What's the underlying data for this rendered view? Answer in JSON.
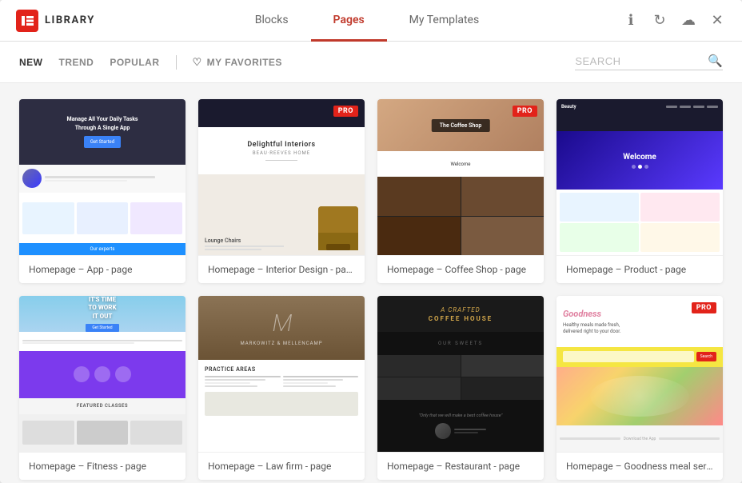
{
  "header": {
    "logo_text": "LIBRARY",
    "tabs": [
      {
        "id": "blocks",
        "label": "Blocks",
        "active": false
      },
      {
        "id": "pages",
        "label": "Pages",
        "active": true
      },
      {
        "id": "my-templates",
        "label": "My Templates",
        "active": false
      }
    ],
    "icons": {
      "info": "ℹ",
      "refresh": "↻",
      "save": "☁",
      "close": "✕"
    }
  },
  "filters": {
    "new_label": "NEW",
    "trend_label": "TREND",
    "popular_label": "POPULAR",
    "favorites_label": "MY FAVORITES"
  },
  "search": {
    "placeholder": "SEARCH"
  },
  "templates": [
    {
      "id": "app",
      "label": "Homepage – App - page",
      "pro": false,
      "thumb_type": "app"
    },
    {
      "id": "interior",
      "label": "Homepage – Interior Design - page",
      "pro": true,
      "thumb_type": "interior"
    },
    {
      "id": "coffee",
      "label": "Homepage – Coffee Shop - page",
      "pro": true,
      "thumb_type": "coffee"
    },
    {
      "id": "product",
      "label": "Homepage – Product - page",
      "pro": false,
      "thumb_type": "product"
    },
    {
      "id": "fitness",
      "label": "Homepage – Fitness - page",
      "pro": false,
      "thumb_type": "fitness"
    },
    {
      "id": "law",
      "label": "Homepage – Law firm - page",
      "pro": false,
      "thumb_type": "law"
    },
    {
      "id": "restaurant",
      "label": "Homepage – Restaurant - page",
      "pro": false,
      "thumb_type": "restaurant"
    },
    {
      "id": "goodness",
      "label": "Homepage – Goodness meal servi...",
      "pro": true,
      "thumb_type": "goodness"
    }
  ]
}
